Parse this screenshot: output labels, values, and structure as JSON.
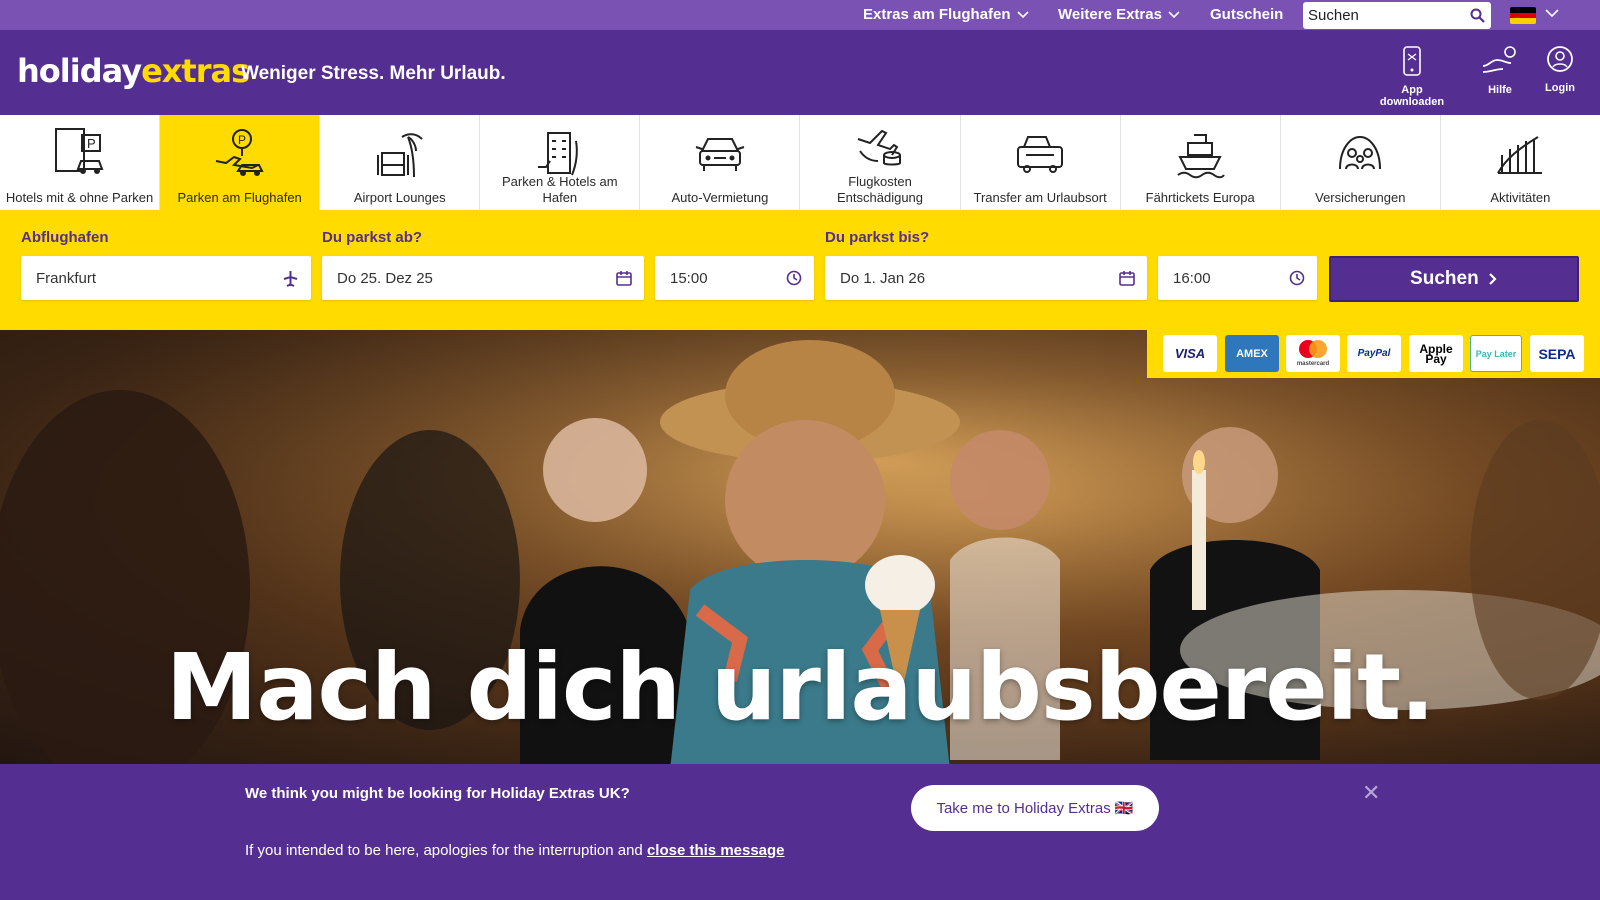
{
  "utility": {
    "extras_airport": "Extras am Flughafen",
    "more_extras": "Weitere Extras",
    "voucher": "Gutschein",
    "search_placeholder": "Suchen"
  },
  "header": {
    "logo_part1": "holiday",
    "logo_part2": "extras",
    "tagline": "Weniger Stress. Mehr Urlaub.",
    "app_download": "App downloaden",
    "help": "Hilfe",
    "login": "Login"
  },
  "tabs": [
    {
      "label": "Hotels mit & ohne Parken",
      "icon": "hotel-parking-icon",
      "active": false
    },
    {
      "label": "Parken am Flughafen",
      "icon": "airport-parking-icon",
      "active": true
    },
    {
      "label": "Airport Lounges",
      "icon": "lounge-icon",
      "active": false
    },
    {
      "label": "Parken & Hotels am Hafen",
      "icon": "port-hotel-icon",
      "active": false
    },
    {
      "label": "Auto-Vermietung",
      "icon": "car-rental-icon",
      "active": false
    },
    {
      "label": "Flugkosten Entschädigung",
      "icon": "flight-compensation-icon",
      "active": false
    },
    {
      "label": "Transfer am Urlaubsort",
      "icon": "transfer-bus-icon",
      "active": false
    },
    {
      "label": "Fährtickets Europa",
      "icon": "ferry-icon",
      "active": false
    },
    {
      "label": "Versicherungen",
      "icon": "insurance-people-icon",
      "active": false
    },
    {
      "label": "Aktivitäten",
      "icon": "activities-icon",
      "active": false
    }
  ],
  "search": {
    "airport_label": "Abflughafen",
    "airport_value": "Frankfurt",
    "from_label": "Du parkst ab?",
    "from_date": "Do 25. Dez 25",
    "from_time": "15:00",
    "to_label": "Du parkst bis?",
    "to_date": "Do 1. Jan 26",
    "to_time": "16:00",
    "button": "Suchen"
  },
  "payments": [
    "VISA",
    "AMEX",
    "mastercard",
    "PayPal",
    "Apple Pay",
    "Pay Later",
    "SEPA"
  ],
  "hero": {
    "headline": "Mach dich urlaubsbereit."
  },
  "banner": {
    "title": "We think you might be looking for Holiday Extras UK?",
    "text": "If you intended to be here, apologies for the interruption and",
    "close_link": "close this message",
    "button": "Take me to Holiday Extras 🇬🇧",
    "close_symbol": "✕"
  },
  "colors": {
    "brand_purple": "#542e91",
    "brand_yellow": "#ffdb00",
    "utility_purple": "#7a52b3"
  }
}
